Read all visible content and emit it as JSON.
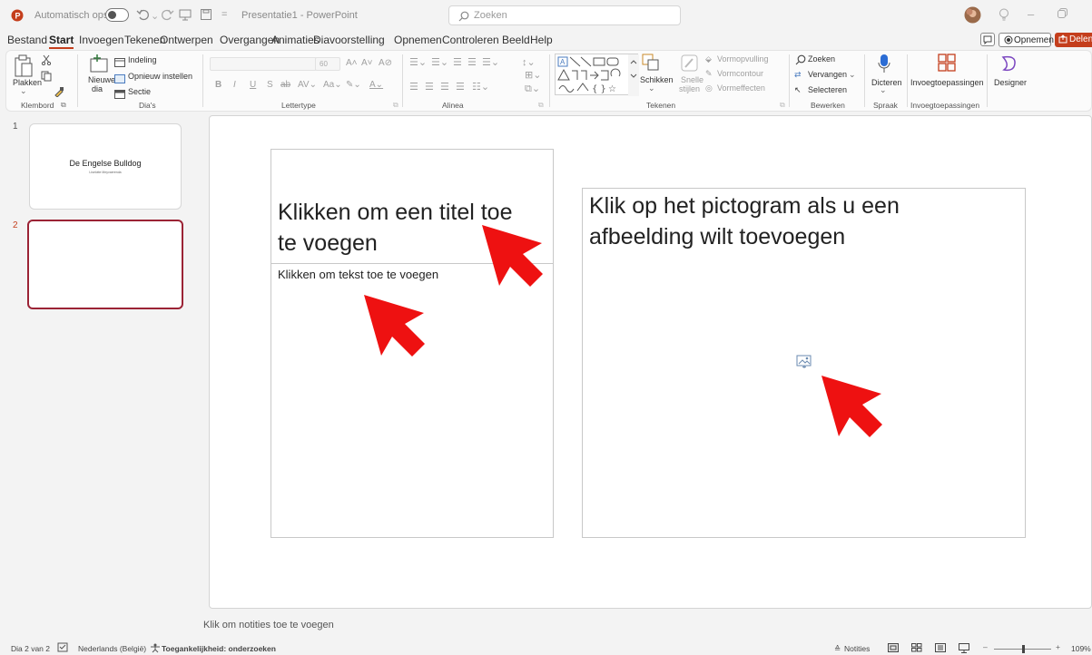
{
  "app": {
    "autosave_label": "Automatisch opslaan",
    "document_title": "Presentatie1 - PowerPoint",
    "search_placeholder": "Zoeken"
  },
  "menu": {
    "file": "Bestand",
    "tabs": [
      "Start",
      "Invoegen",
      "Tekenen",
      "Ontwerpen",
      "Overgangen",
      "Animaties",
      "Diavoorstelling",
      "Opnemen",
      "Controleren",
      "Beeld",
      "Help"
    ],
    "active_tab": "Start",
    "record_button": "Opnemen",
    "share_button": "Delen"
  },
  "ribbon": {
    "clipboard": {
      "paste": "Plakken",
      "group": "Klembord"
    },
    "slides": {
      "new_slide": "Nieuwe",
      "new_slide_2": "dia",
      "layout": "Indeling",
      "reset": "Opnieuw instellen",
      "section": "Sectie",
      "group": "Dia's"
    },
    "font": {
      "size": "60",
      "group": "Lettertype"
    },
    "paragraph": {
      "group": "Alinea"
    },
    "drawing": {
      "arrange": "Schikken",
      "quick_styles": "Snelle",
      "quick_styles_2": "stijlen",
      "shape_fill": "Vormopvulling",
      "shape_outline": "Vormcontour",
      "shape_effects": "Vormeffecten",
      "group": "Tekenen"
    },
    "editing": {
      "find": "Zoeken",
      "replace": "Vervangen",
      "select": "Selecteren",
      "group": "Bewerken"
    },
    "voice": {
      "dictate": "Dicteren",
      "group": "Spraak"
    },
    "addins": {
      "addins": "Invoegtoepassingen",
      "group": "Invoegtoepassingen"
    },
    "designer": {
      "label": "Designer"
    }
  },
  "thumbnails": [
    {
      "number": "1",
      "title": "De Engelse Bulldog",
      "subtitle": "Liselotte Meyvaerenda"
    },
    {
      "number": "2"
    }
  ],
  "slide": {
    "title_placeholder": "Klikken om een titel toe te voegen",
    "text_placeholder": "Klikken om tekst toe te voegen",
    "picture_placeholder": "Klik op het pictogram als u een afbeelding wilt toevoegen"
  },
  "notes_placeholder": "Klik om notities toe te voegen",
  "status": {
    "slide_count": "Dia 2 van 2",
    "language": "Nederlands (België)",
    "accessibility": "Toegankelijkheid: onderzoeken",
    "notes": "Notities",
    "zoom": "109%"
  },
  "colors": {
    "accent": "#c43e1c",
    "annotation_arrow": "#ee1111",
    "selected_thumb": "#9b2335"
  }
}
